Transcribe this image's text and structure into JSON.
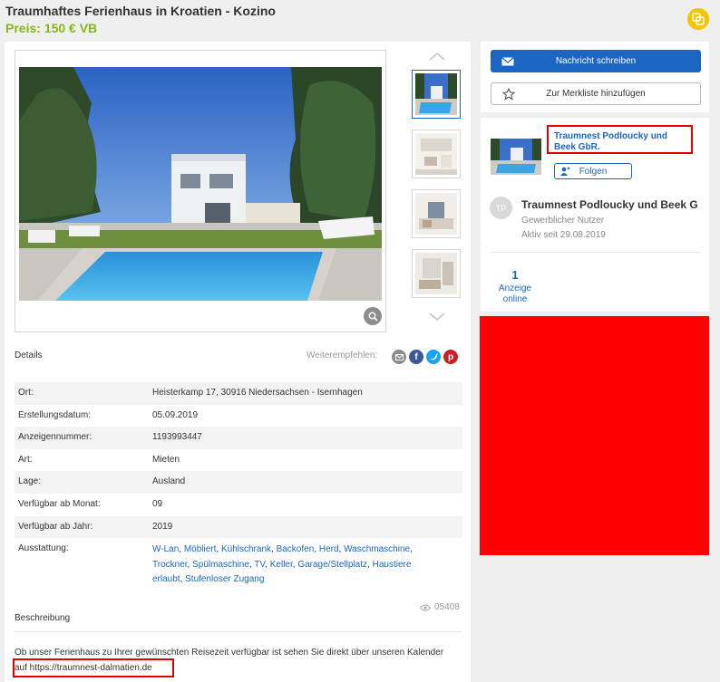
{
  "listing": {
    "title": "Traumhaftes Ferienhaus in Kroatien - Kozino",
    "price": "Preis: 150 € VB"
  },
  "colors": {
    "accent": "#1a66c2",
    "price_green": "#86b817",
    "share_yellow": "#f5c400",
    "highlight_red": "#e00000",
    "ad_red": "#ff0000"
  },
  "gallery": {
    "thumbnail_count": 4,
    "active_thumbnail": 1
  },
  "details": {
    "heading": "Details",
    "share_label": "Weiterempfehlen:",
    "rows": [
      {
        "label": "Ort:",
        "value": "Heisterkamp 17, 30916 Niedersachsen - Isernhagen"
      },
      {
        "label": "Erstellungsdatum:",
        "value": "05.09.2019"
      },
      {
        "label": "Anzeigennummer:",
        "value": "1193993447"
      },
      {
        "label": "Art:",
        "value": "Mieten"
      },
      {
        "label": "Lage:",
        "value": "Ausland"
      },
      {
        "label": "Verfügbar ab Monat:",
        "value": "09"
      },
      {
        "label": "Verfügbar ab Jahr:",
        "value": "2019"
      }
    ],
    "features_label": "Ausstattung:",
    "features": [
      "W-Lan",
      "Möbliert",
      "Kühlschrank",
      "Backofen",
      "Herd",
      "Waschmaschine",
      "Trockner",
      "Spülmaschine",
      "TV",
      "Keller",
      "Garage/Stellplatz",
      "Haustiere erlaubt",
      "Stufenloser Zugang"
    ]
  },
  "description": {
    "views": "05408",
    "heading": "Beschreibung",
    "text": "Ob unser Ferienhaus zu Ihrer gewünschten Reisezeit verfügbar ist sehen Sie direkt über unseren Kalender",
    "url_text": "auf https://traumnest-dalmatien.de"
  },
  "actions": {
    "message_button": "Nachricht schreiben",
    "watchlist_button": "Zur Merkliste hinzufügen"
  },
  "seller": {
    "name_link": "Traumnest Podloucky und Beek GbR.",
    "follow_button": "Folgen",
    "initials": "TP",
    "name": "Traumnest Podloucky und Beek G",
    "type": "Gewerblicher Nutzer",
    "active_since": "Aktiv seit 29.08.2019",
    "ads_count": "1",
    "ads_label": "Anzeige online"
  },
  "icons": {
    "share": "share-icon",
    "zoom": "magnifier-icon",
    "envelope": "envelope-icon",
    "star": "star-outline-icon",
    "follow": "add-user-icon",
    "eye": "eye-icon"
  }
}
